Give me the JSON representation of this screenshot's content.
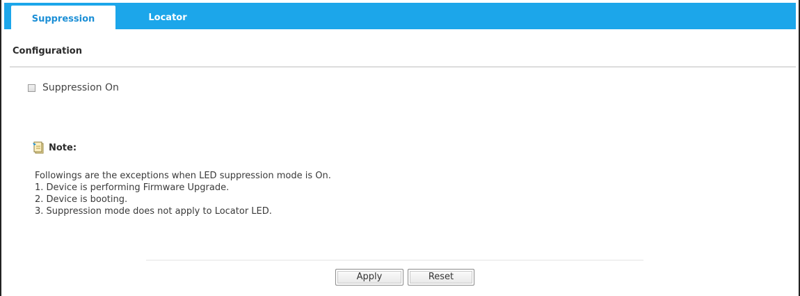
{
  "tabs": [
    {
      "label": "Suppression",
      "active": true
    },
    {
      "label": "Locator",
      "active": false
    }
  ],
  "colors": {
    "tab_bar": "#1ca6ea",
    "active_tab_text": "#1c8fd6"
  },
  "configuration": {
    "title": "Configuration",
    "suppression_checkbox": {
      "label": "Suppression On",
      "checked": false
    }
  },
  "note": {
    "icon": "note-icon",
    "title": "Note:",
    "lines": [
      "Followings are the exceptions when LED suppression mode is On.",
      "1. Device is performing Firmware Upgrade.",
      "2. Device is booting.",
      "3. Suppression mode does not apply to Locator LED."
    ]
  },
  "buttons": {
    "apply": "Apply",
    "reset": "Reset"
  }
}
